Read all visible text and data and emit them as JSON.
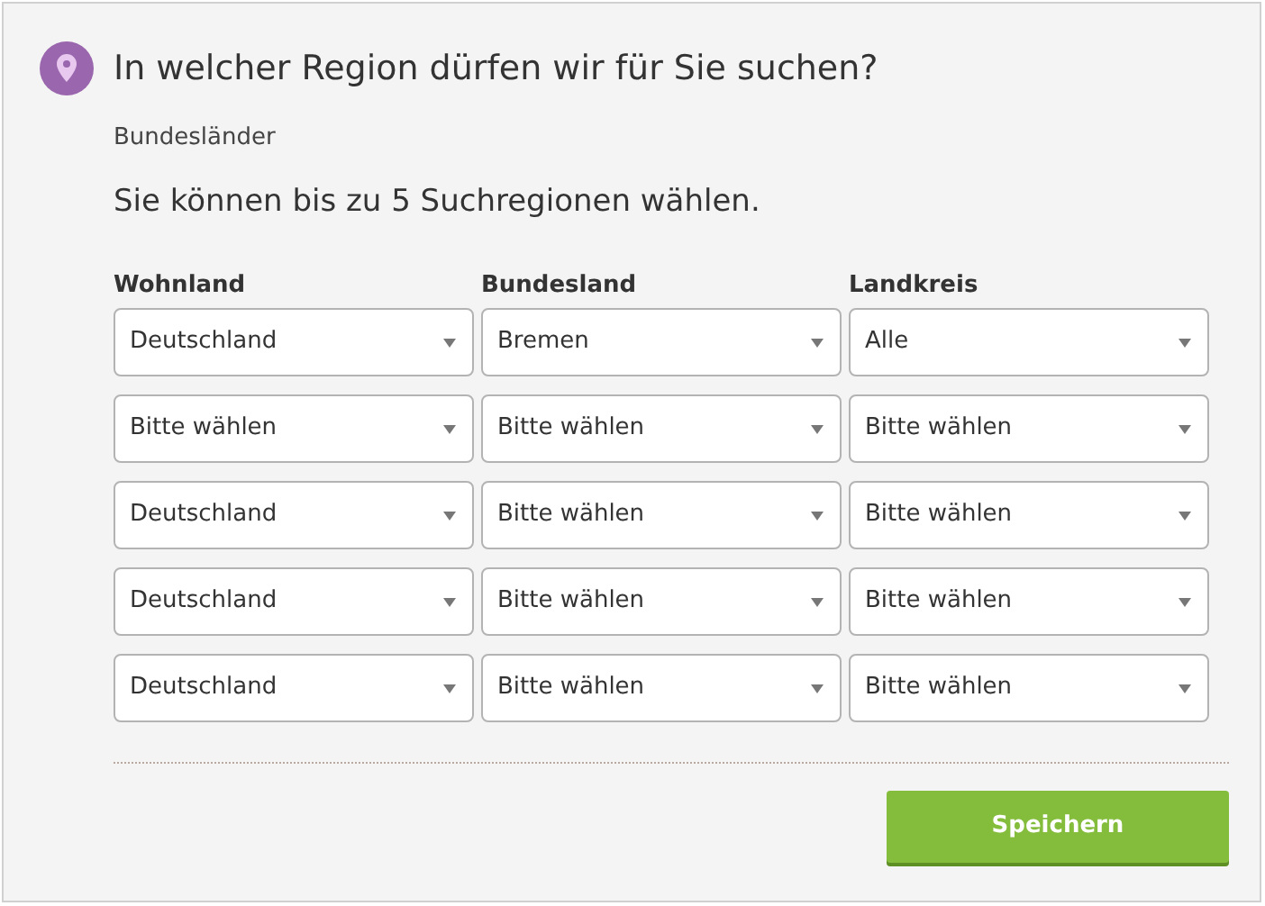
{
  "title": "In welcher Region dürfen wir für Sie suchen?",
  "section_label": "Bundesländer",
  "instruction": "Sie können bis zu 5 Suchregionen wählen.",
  "columns": [
    "Wohnland",
    "Bundesland",
    "Landkreis"
  ],
  "rows": [
    [
      "Deutschland",
      "Bremen",
      "Alle"
    ],
    [
      "Bitte wählen",
      "Bitte wählen",
      "Bitte wählen"
    ],
    [
      "Deutschland",
      "Bitte wählen",
      "Bitte wählen"
    ],
    [
      "Deutschland",
      "Bitte wählen",
      "Bitte wählen"
    ],
    [
      "Deutschland",
      "Bitte wählen",
      "Bitte wählen"
    ]
  ],
  "save_button": "Speichern"
}
